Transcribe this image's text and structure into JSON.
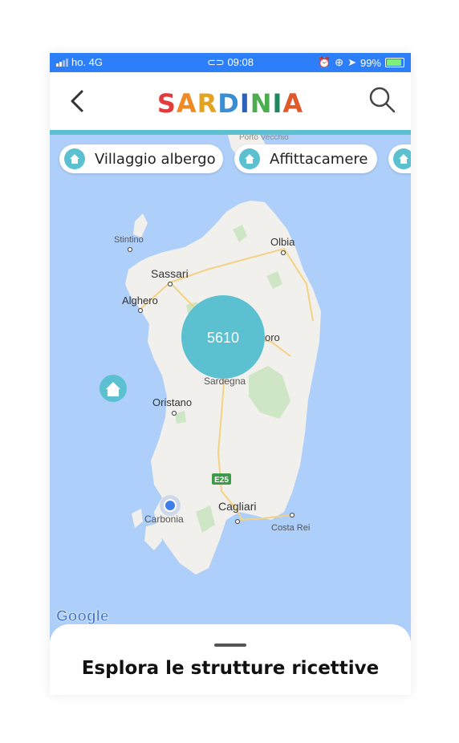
{
  "status_bar": {
    "carrier": "ho. 4G",
    "time": "09:08",
    "battery": "99%",
    "colors": {
      "background": "#2d7ff9"
    }
  },
  "header": {
    "logo_text": "SARDINIA",
    "back_icon": "chevron-left-icon",
    "search_icon": "search-icon"
  },
  "filters": [
    {
      "label": "Villaggio albergo",
      "icon": "home-icon"
    },
    {
      "label": "Affittacamere",
      "icon": "home-icon"
    }
  ],
  "map": {
    "cluster_count": "5610",
    "places": {
      "stintino": "Stintino",
      "olbia": "Olbia",
      "sassari": "Sassari",
      "alghero": "Alghero",
      "nuoro_partial": "oro",
      "sardegna_partial": "Sardegna",
      "oristano": "Oristano",
      "road": "E25",
      "carbonia": "Carbonia",
      "cagliari": "Cagliari",
      "costa_rei": "Costa Rei",
      "porto_vecchio_partial": "Porto Vecchio"
    },
    "attribution": "Google",
    "colors": {
      "water": "#aecffa",
      "land": "#f1f0ec",
      "cluster": "#5bc0cf",
      "location": "#3f7ee8"
    }
  },
  "bottom_sheet": {
    "title": "Esplora le strutture ricettive"
  }
}
